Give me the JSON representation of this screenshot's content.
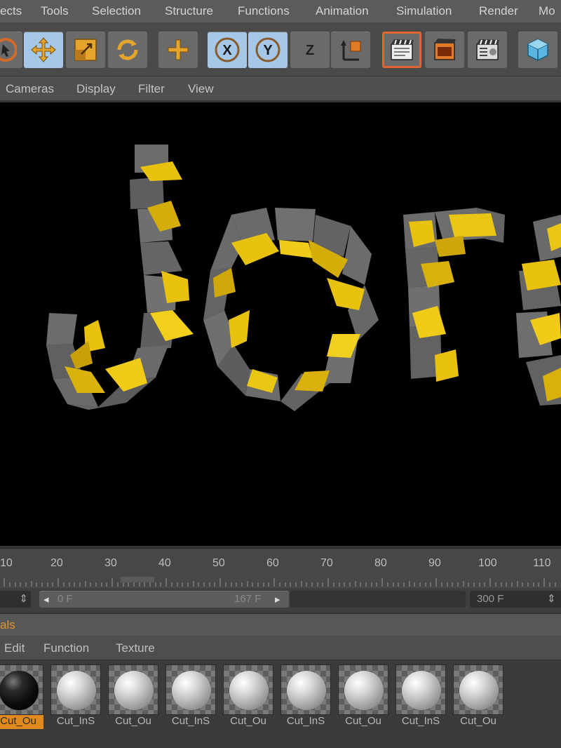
{
  "menubar": {
    "items": [
      "ects",
      "Tools",
      "Selection",
      "Structure",
      "Functions",
      "Animation",
      "Simulation",
      "Render",
      "Mo"
    ]
  },
  "toolbar": {
    "icons": [
      "live-selection-icon",
      "move-icon",
      "scale-icon",
      "rotate-icon",
      "add-icon",
      "x-axis-icon",
      "y-axis-icon",
      "z-axis-icon",
      "coordinate-system-icon",
      "render-view-icon",
      "render-picture-viewer-icon",
      "render-settings-icon",
      "cube-icon"
    ],
    "labels": {
      "x": "X",
      "y": "Y",
      "z": "Z"
    }
  },
  "view_menu": {
    "items": [
      "Cameras",
      "Display",
      "Filter",
      "View"
    ]
  },
  "timeline": {
    "ticks": [
      "10",
      "20",
      "30",
      "40",
      "50",
      "60",
      "70",
      "80",
      "90",
      "100",
      "110"
    ]
  },
  "range": {
    "start": "0 F",
    "end": "167 F",
    "max": "300 F"
  },
  "materials": {
    "header": "als",
    "menu": [
      "Edit",
      "Function",
      "Texture"
    ],
    "items": [
      {
        "name": "Cut_Ou",
        "selected": true,
        "kind": "black"
      },
      {
        "name": "Cut_InS",
        "selected": false,
        "kind": "white"
      },
      {
        "name": "Cut_Ou",
        "selected": false,
        "kind": "white"
      },
      {
        "name": "Cut_InS",
        "selected": false,
        "kind": "white"
      },
      {
        "name": "Cut_Ou",
        "selected": false,
        "kind": "white"
      },
      {
        "name": "Cut_InS",
        "selected": false,
        "kind": "white"
      },
      {
        "name": "Cut_Ou",
        "selected": false,
        "kind": "white"
      },
      {
        "name": "Cut_InS",
        "selected": false,
        "kind": "white"
      },
      {
        "name": "Cut_Ou",
        "selected": false,
        "kind": "white"
      }
    ]
  },
  "colors": {
    "accent_orange": "#e08a1e",
    "active_blue": "#a5c8e8",
    "fragment_yellow": "#e8c20e",
    "fragment_gray": "#6b6b6b"
  }
}
